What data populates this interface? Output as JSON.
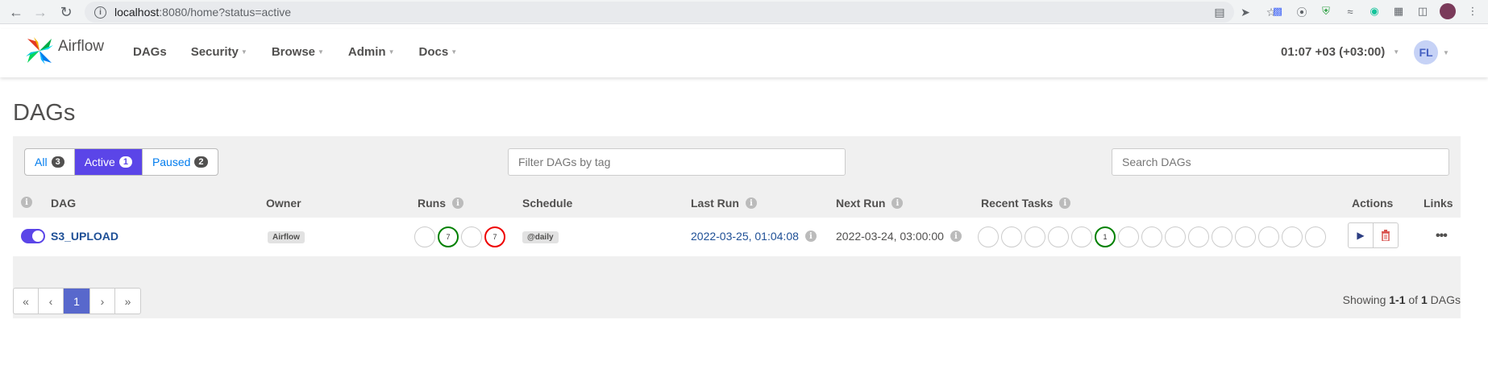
{
  "browser": {
    "url_host": "localhost",
    "url_path": ":8080/home?status=active"
  },
  "navbar": {
    "brand": "Airflow",
    "items": [
      {
        "label": "DAGs",
        "has_caret": false
      },
      {
        "label": "Security",
        "has_caret": true
      },
      {
        "label": "Browse",
        "has_caret": true
      },
      {
        "label": "Admin",
        "has_caret": true
      },
      {
        "label": "Docs",
        "has_caret": true
      }
    ],
    "clock": "01:07 +03 (+03:00)",
    "user_initials": "FL"
  },
  "page": {
    "title": "DAGs",
    "status_filters": [
      {
        "label": "All",
        "count": "3",
        "active": false
      },
      {
        "label": "Active",
        "count": "1",
        "active": true
      },
      {
        "label": "Paused",
        "count": "2",
        "active": false
      }
    ],
    "tag_filter_placeholder": "Filter DAGs by tag",
    "search_placeholder": "Search DAGs"
  },
  "table": {
    "headers": {
      "dag": "DAG",
      "owner": "Owner",
      "runs": "Runs",
      "schedule": "Schedule",
      "last_run": "Last Run",
      "next_run": "Next Run",
      "recent_tasks": "Recent Tasks",
      "actions": "Actions",
      "links": "Links"
    },
    "rows": [
      {
        "dag_id": "S3_UPLOAD",
        "active": true,
        "owner": "Airflow",
        "runs": [
          {
            "state": "queued",
            "count": ""
          },
          {
            "state": "success",
            "count": "7"
          },
          {
            "state": "running",
            "count": ""
          },
          {
            "state": "failed",
            "count": "7"
          }
        ],
        "schedule": "@daily",
        "last_run": "2022-03-25, 01:04:08",
        "next_run": "2022-03-24, 03:00:00",
        "recent_tasks": [
          "",
          "",
          "",
          "",
          "",
          "1",
          "",
          "",
          "",
          "",
          "",
          "",
          "",
          "",
          ""
        ],
        "recent_tasks_success_index": 5
      }
    ]
  },
  "pagination": {
    "pages": [
      "«",
      "‹",
      "1",
      "›",
      "»"
    ],
    "current": "1",
    "showing_prefix": "Showing ",
    "showing_range": "1-1",
    "showing_of": " of ",
    "showing_total": "1",
    "showing_suffix": " DAGs"
  },
  "colors": {
    "accent": "#5b45e8",
    "success": "#008000",
    "failed": "#ee0000",
    "link": "#1e4f96"
  }
}
